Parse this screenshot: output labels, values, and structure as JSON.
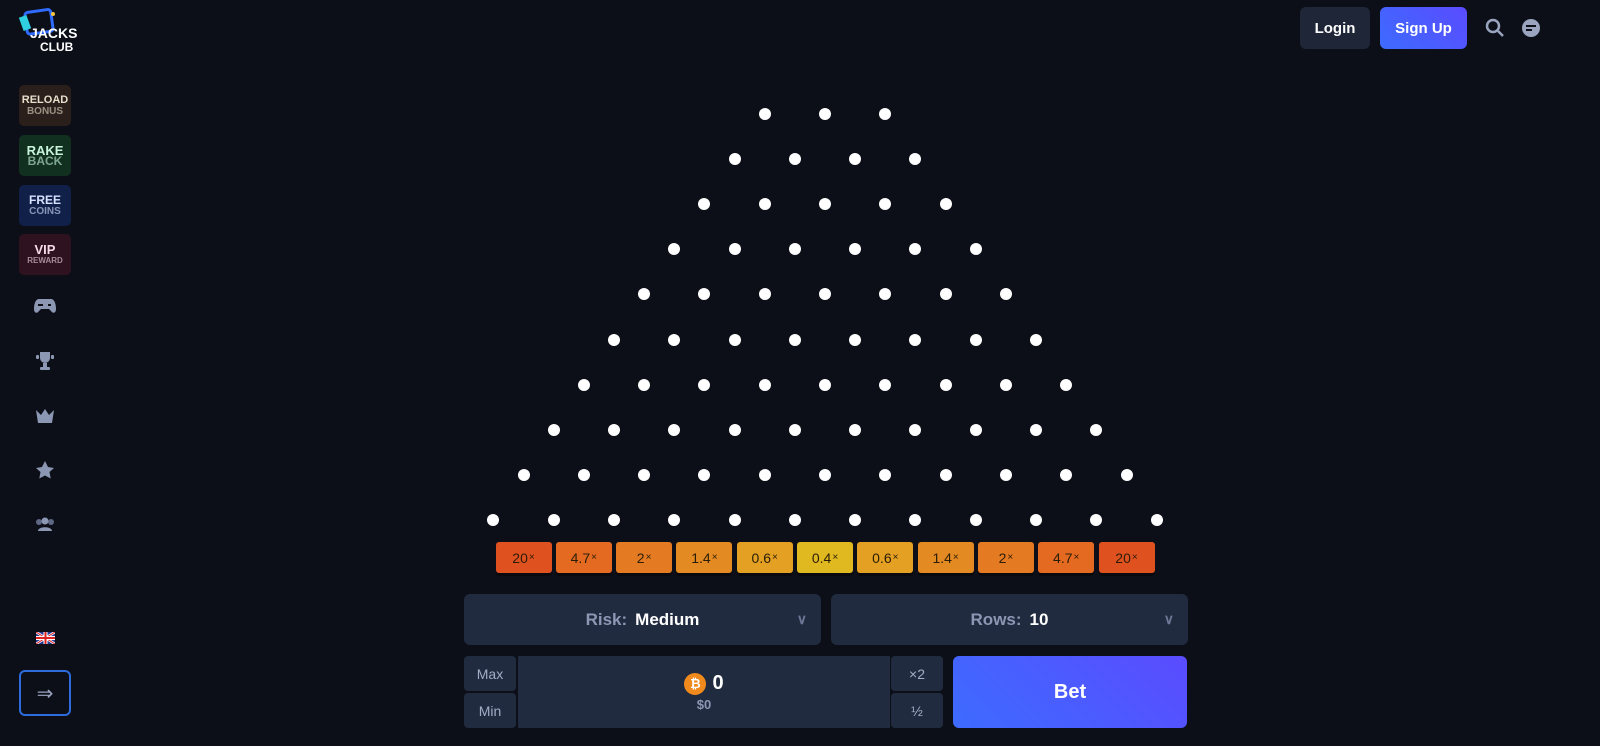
{
  "brand": {
    "logo_text": "JACKS CLUB"
  },
  "sidebar": {
    "promos": [
      {
        "line1": "RELOAD",
        "line2": "BONUS",
        "bg": "#2a1f1a",
        "color": "#e8dccb"
      },
      {
        "line1": "RAKE",
        "line2": "BACK",
        "bg": "#11301f",
        "color": "#c8f5dc"
      },
      {
        "line1": "FREE",
        "line2": "COINS",
        "bg": "#102049",
        "color": "#d8e2ff"
      },
      {
        "line1": "VIP",
        "line2": "REWARD",
        "bg": "#2e121f",
        "color": "#f4dbe5"
      }
    ],
    "nav_icons": [
      "gamepad-icon",
      "trophy-icon",
      "crown-icon",
      "star-icon",
      "users-icon"
    ],
    "language": "uk-flag-icon"
  },
  "header": {
    "login": "Login",
    "signup": "Sign Up"
  },
  "game": {
    "rows": 10,
    "multipliers": [
      "20",
      "4.7",
      "2",
      "1.4",
      "0.6",
      "0.4",
      "0.6",
      "1.4",
      "2",
      "4.7",
      "20"
    ],
    "multiplier_suffix": "×",
    "bin_colors": [
      "#e05120",
      "#e46a22",
      "#e47a22",
      "#e48a22",
      "#e4a022",
      "#e0b820",
      "#e4a022",
      "#e48a22",
      "#e47a22",
      "#e46a22",
      "#e05120"
    ]
  },
  "controls": {
    "risk_label": "Risk:",
    "risk_value": "Medium",
    "rows_label": "Rows:",
    "rows_value": "10",
    "max": "Max",
    "min": "Min",
    "double": "×2",
    "half": "½",
    "amount": "0",
    "amount_usd": "$0",
    "bet": "Bet"
  }
}
